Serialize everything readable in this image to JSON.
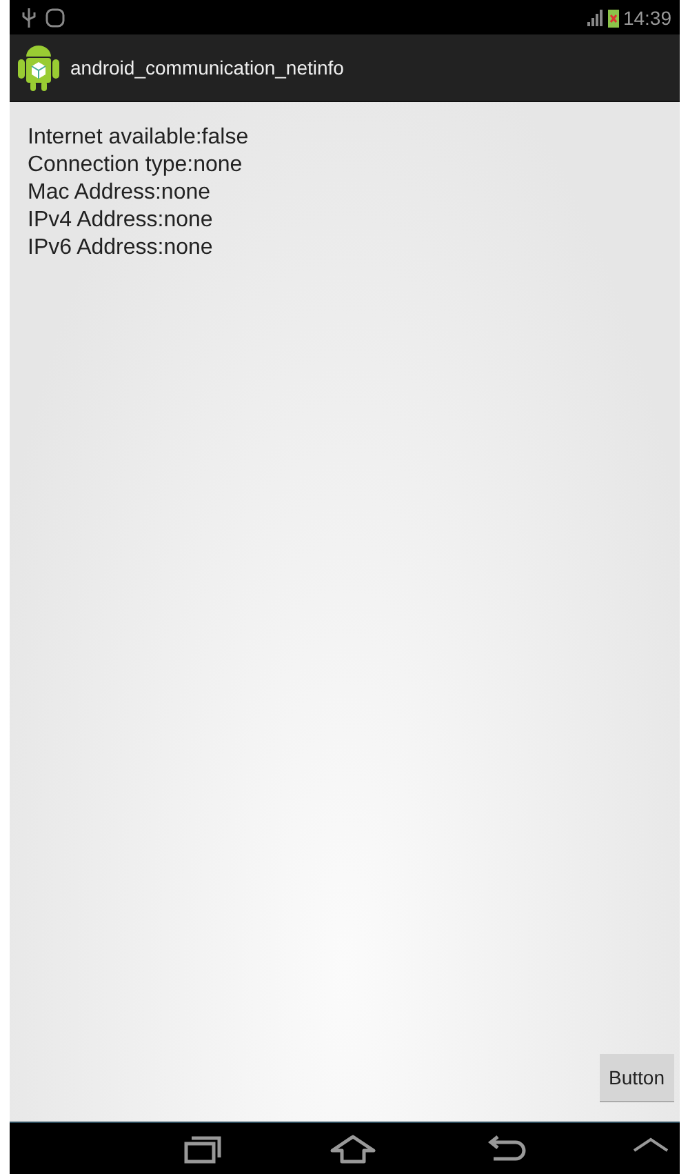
{
  "status_bar": {
    "time": "14:39"
  },
  "action_bar": {
    "title": "android_communication_netinfo"
  },
  "info_lines": [
    "Internet available:false",
    "Connection type:none",
    "Mac Address:none",
    "IPv4 Address:none",
    "IPv6 Address:none"
  ],
  "button": {
    "label": "Button"
  }
}
